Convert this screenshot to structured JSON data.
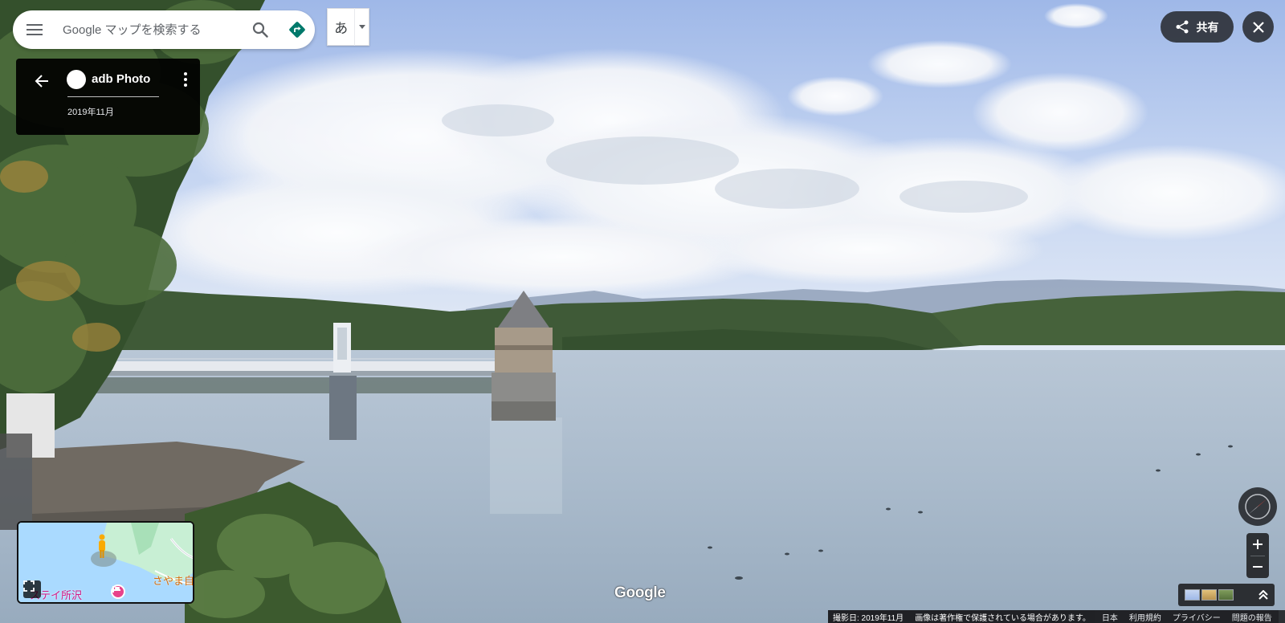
{
  "search": {
    "placeholder": "Google マップを検索する"
  },
  "ime": {
    "char": "あ"
  },
  "photo_card": {
    "author": "adb Photo",
    "date": "2019年11月"
  },
  "share": {
    "label": "共有"
  },
  "minimap": {
    "label_hotel": "ステイ所沢",
    "label_park": "さやま自"
  },
  "logo": {
    "text": "Google"
  },
  "footer": {
    "capture_date": "撮影日: 2019年11月",
    "copyright": "画像は著作権で保護されている場合があります。",
    "country": "日本",
    "terms": "利用規約",
    "privacy": "プライバシー",
    "report": "問題の報告"
  },
  "colors": {
    "accent_directions": "#00796b",
    "dark_overlay": "#202124",
    "minimap_park": "#c8efd4",
    "minimap_water": "#aadaff",
    "pegman": "#f9ab00"
  }
}
